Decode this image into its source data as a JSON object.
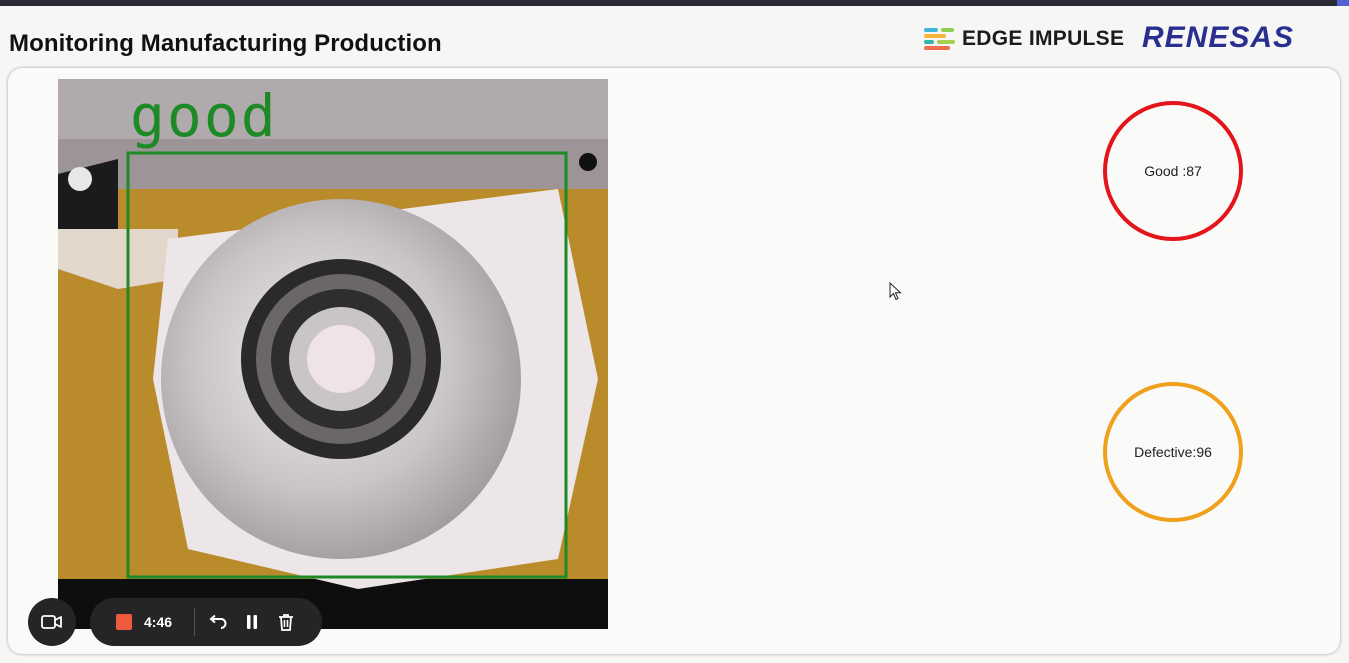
{
  "header": {
    "title": "Monitoring Manufacturing Production",
    "logo_edge_impulse": "EDGE IMPULSE",
    "logo_renesas": "RENESAS"
  },
  "video": {
    "detection_label": "good",
    "box_color": "#1d8a25"
  },
  "counters": {
    "good_label": "Good :87",
    "defective_label": "Defective:96",
    "good_color": "#e3151b",
    "defective_color": "#f0a11b"
  },
  "recorder": {
    "time": "4:46",
    "camera_icon": "video-camera-icon",
    "stop_icon": "stop-icon",
    "undo_icon": "undo-icon",
    "pause_icon": "pause-icon",
    "delete_icon": "trash-icon"
  },
  "colors": {
    "accent_red": "#e3151b",
    "accent_orange": "#f0a11b",
    "renesas_blue": "#2a2f8f"
  }
}
